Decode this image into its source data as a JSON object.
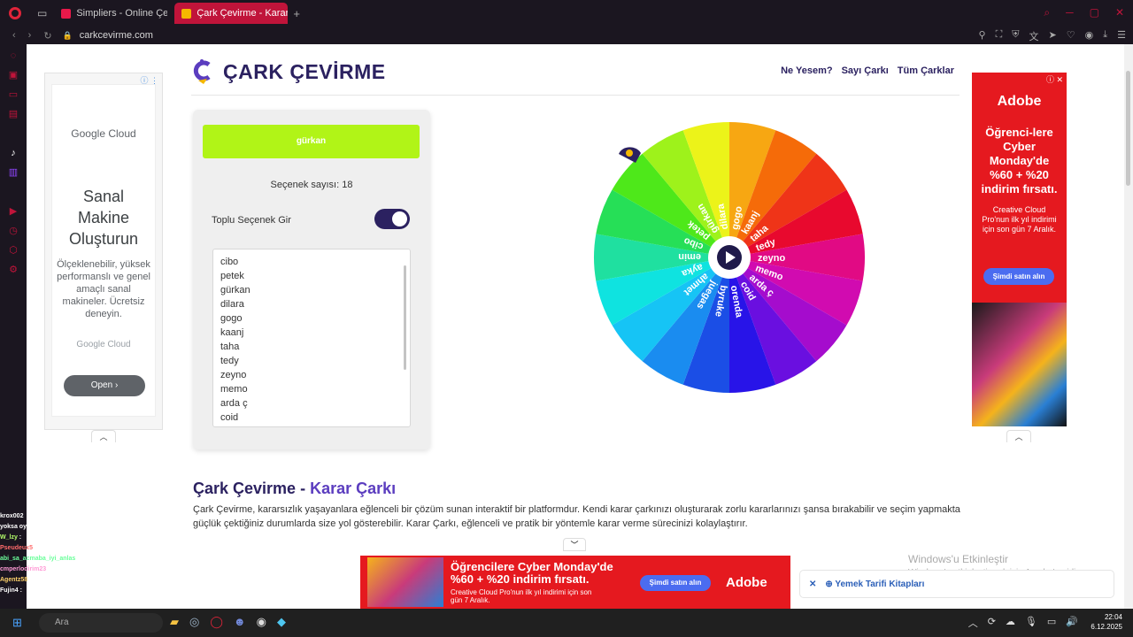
{
  "browser": {
    "tabs": [
      {
        "title": "Simpliers - Online Çekiliş",
        "active": false
      },
      {
        "title": "Çark Çevirme - Karar Çarkı",
        "active": true
      }
    ],
    "url": "carkcevirme.com"
  },
  "header": {
    "logo_text": "ÇARK ÇEVİRME",
    "menu": [
      "Ne Yesem?",
      "Sayı Çarkı",
      "Tüm Çarklar"
    ]
  },
  "panel": {
    "result": "gürkan",
    "count_label": "Seçenek sayısı: 18",
    "bulk_label": "Toplu Seçenek Gir",
    "bulk_enabled": true,
    "options": [
      "cibo",
      "petek",
      "gürkan",
      "dilara",
      "gogo",
      "kaanj",
      "taha",
      "tedy",
      "zeyno",
      "memo",
      "arda ç",
      "coid"
    ]
  },
  "wheel": {
    "labels": [
      "gogo",
      "kaanj",
      "taha",
      "tedy",
      "zeyno",
      "memo",
      "arda ç",
      "coid",
      "orenda",
      "byruke",
      "juegas",
      "ahmet",
      "ayka",
      "emin",
      "cibo",
      "petek",
      "gürkan",
      "dilara"
    ],
    "colors": [
      "#f7a712",
      "#f56b09",
      "#ef3418",
      "#e8092e",
      "#e10a84",
      "#d10bb0",
      "#a50ccd",
      "#6a0fe0",
      "#2814e8",
      "#1b4ee6",
      "#1a8cf0",
      "#16c4f5",
      "#0fe3e0",
      "#1fe0a0",
      "#26df57",
      "#4ee81a",
      "#9ef21b",
      "#ecf319"
    ]
  },
  "section": {
    "title_a": "Çark Çevirme - ",
    "title_b": "Karar Çarkı",
    "text": "Çark Çevirme, kararsızlık yaşayanlara eğlenceli bir çözüm sunan interaktif bir platformdur. Kendi karar çarkınızı oluşturarak zorlu kararlarınızı şansa bırakabilir ve seçim yapmakta güçlük çektiğiniz durumlarda size yol gösterebilir. Karar Çarkı, eğlenceli ve pratik bir yöntemle karar verme sürecinizi kolaylaştırır."
  },
  "ad_left": {
    "brand": "Google Cloud",
    "headline": "Sanal Makine Oluşturun",
    "body": "Ölçeklenebilir, yüksek performanslı ve genel amaçlı sanal makineler. Ücretsiz deneyin.",
    "footer": "Google Cloud",
    "button": "Open"
  },
  "ad_right": {
    "brand": "Adobe",
    "headline": "Öğrenci-lere Cyber Monday'de %60 + %20 indirim fırsatı.",
    "body": "Creative Cloud Pro'nun ilk yıl indirimi için son gün 7 Aralık.",
    "button": "Şimdi satın alın"
  },
  "ad_bottom": {
    "headline": "Öğrencilere Cyber Monday'de %60 + %20 indirim fırsatı.",
    "body": "Creative Cloud Pro'nun ilk yıl indirimi için son gün 7 Aralık.",
    "button": "Şimdi satın alın",
    "brand": "Adobe"
  },
  "side_banner": {
    "label": "Yemek Tarifi Kitapları"
  },
  "watermark": {
    "title": "Windows'u Etkinleştir",
    "sub": "Windows'u etkinleştirmek için Ayarlar'a gidin."
  },
  "taskbar": {
    "search": "Ara",
    "time": "22:04",
    "date": "6.12.2025"
  },
  "chat": [
    {
      "name": "krox002",
      "text": "",
      "color": "#ffffff"
    },
    {
      "name": "",
      "text": "yoksa oyu seksebi",
      "color": "#9bb0ff"
    },
    {
      "name": "W_lzy",
      "text": ":",
      "color": "#b5ff6b"
    },
    {
      "name": "Pseudeux5",
      "text": ":",
      "color": "#ff6b6b"
    },
    {
      "name": "abi_sa_acmaba_iyi_anlas",
      "text": ":",
      "color": "#6bff9b"
    },
    {
      "name": "cmperlodirim23",
      "text": ":",
      "color": "#ff9bd6"
    },
    {
      "name": "Agentz58",
      "text": ":",
      "color": "#ffd36b"
    },
    {
      "name": "Fujin4",
      "text": ":",
      "color": "#ffffff"
    }
  ]
}
